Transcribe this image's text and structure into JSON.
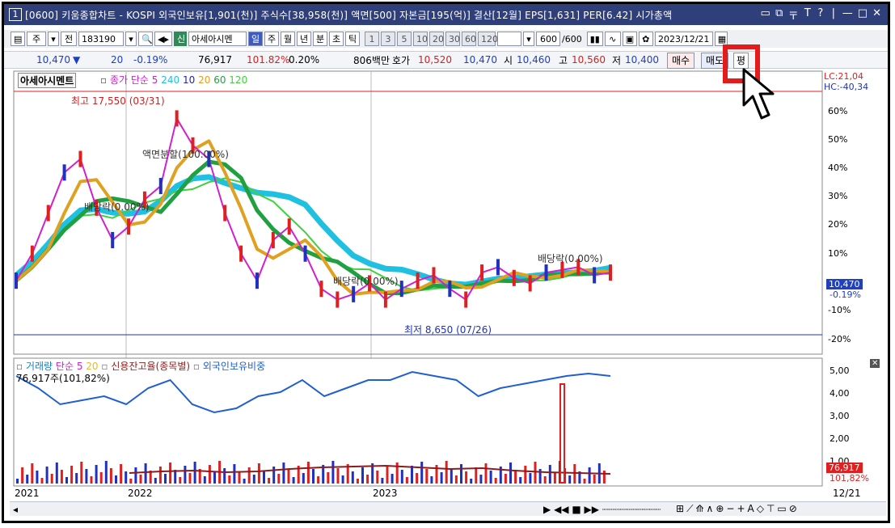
{
  "window": {
    "number": "1",
    "title": "[0600] 키움종합차트 - KOSPI 외국인보유[1,901(천)] 주식수[38,958(천)] 액면[500] 자본금[195(억)] 결산[12월] EPS[1,631] PER[6.42] 시가총액",
    "controls": [
      "□",
      "□",
      "〒",
      "T",
      "?",
      "|",
      "—",
      "□",
      "✕"
    ]
  },
  "toolbar": {
    "type_select": "주",
    "prev_label": "전",
    "code": "183190",
    "stock_badge": "신",
    "stock_name": "아세아시멘",
    "periods": [
      "일",
      "주",
      "월",
      "년",
      "분",
      "초",
      "틱"
    ],
    "active_period": "일",
    "minutes": [
      "1",
      "3",
      "5",
      "10",
      "20",
      "30",
      "60",
      "120"
    ],
    "count_value": "600",
    "count_total": "/600",
    "date_value": "2023/12/21"
  },
  "quote": {
    "price": "10,470",
    "change": "20",
    "change_pct": "-0.19%",
    "volume": "76,917",
    "volume_ratio": "101.82%",
    "turnover": "0.20%",
    "amount": "806백만",
    "bid_label": "호가",
    "bid": "10,520",
    "ask": "10,470",
    "open_label": "시",
    "open": "10,460",
    "high_label": "고",
    "high": "10,560",
    "low_label": "저",
    "low": "10,400",
    "buy_label": "매수",
    "sell_label": "매도",
    "eval_label": "평"
  },
  "price_panel": {
    "stock_tag": "아세아시멘트",
    "legend_prefix": "종가 단순",
    "legend_periods": [
      "5",
      "240",
      "10",
      "20",
      "60",
      "120"
    ],
    "legend_colors": [
      "#d020d0",
      "#20c0e0",
      "#2020c0",
      "#e0a020",
      "#20a040",
      "#40d040"
    ],
    "high_marker": "최고 17,550 (03/31)",
    "low_marker": "최저 8,650 (07/26)",
    "annotations": [
      "액면분할(100.00%)",
      "배당락(0.00%)",
      "배당락(0.00%)",
      "배당락(0.00%)"
    ],
    "y_ticks": [
      "LC:21,04",
      "HC:-40,34",
      "60%",
      "50%",
      "40%",
      "30%",
      "20%",
      "10%",
      "-10%",
      "-20%"
    ],
    "current_price_tag": "10,470",
    "current_change_tag": "-0.19%"
  },
  "volume_panel": {
    "legend": [
      "거래량",
      "단순",
      "5",
      "20",
      "신용잔고율(종목별)",
      "외국인보유비중"
    ],
    "value_label": "76,917주(101,82%)",
    "y_ticks": [
      "5,00",
      "4,00",
      "3,00",
      "2,00",
      "1,00"
    ],
    "current_volume_tag": "76,917",
    "current_ratio_tag": "101,82%"
  },
  "x_axis": {
    "labels": [
      "2021",
      "2022",
      "2023"
    ],
    "end_label": "12/21"
  },
  "chart_data": {
    "type": "line",
    "title": "",
    "series": [
      {
        "values": [
          -5,
          5,
          20,
          35,
          40,
          22,
          10,
          15,
          25,
          30,
          55,
          45,
          40,
          20,
          5,
          -5,
          10,
          15,
          5,
          -8,
          -12,
          -10,
          -6,
          -12,
          -8,
          -5,
          -3,
          -8,
          -12,
          -2,
          0,
          -4,
          -6,
          -2,
          -1,
          0,
          -3,
          -2
        ]
      }
    ],
    "ylim": [
      -25,
      65
    ],
    "colors": {
      "ma5": "#d020d0",
      "ma20": "#e0a020",
      "ma60": "#20a040",
      "ma120": "#40d040",
      "ma240": "#20c0e0",
      "foreign": "#1f5fd0",
      "credit": "#8a1c1c"
    }
  },
  "highlight": {
    "label": "평"
  }
}
